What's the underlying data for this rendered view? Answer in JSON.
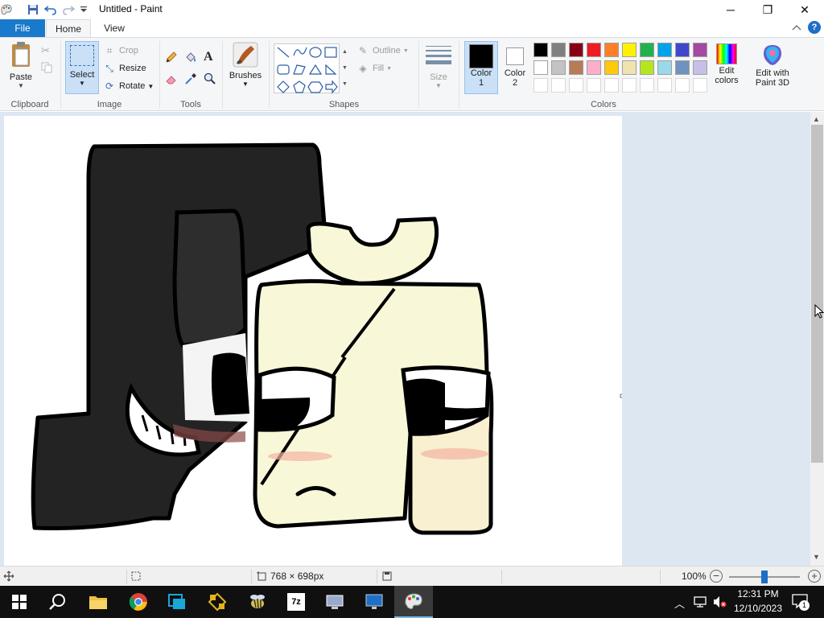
{
  "window": {
    "title": "Untitled - Paint",
    "minimize_glyph": "─",
    "restore_glyph": "❐",
    "close_glyph": "✕"
  },
  "tabs": [
    {
      "label": "File"
    },
    {
      "label": "Home"
    },
    {
      "label": "View"
    }
  ],
  "ribbon": {
    "clipboard": {
      "paste": "Paste",
      "group": "Clipboard"
    },
    "image": {
      "select": "Select",
      "crop": "Crop",
      "resize": "Resize",
      "rotate": "Rotate",
      "group": "Image"
    },
    "tools": {
      "group": "Tools"
    },
    "brushes": {
      "label": "Brushes"
    },
    "shapes": {
      "outline": "Outline",
      "fill": "Fill",
      "group": "Shapes"
    },
    "size": {
      "label": "Size"
    },
    "colors": {
      "color1": "Color",
      "color1_num": "1",
      "color2": "Color",
      "color2_num": "2",
      "edit_colors_1": "Edit",
      "edit_colors_2": "colors",
      "paint3d_1": "Edit with",
      "paint3d_2": "Paint 3D",
      "group": "Colors",
      "color1_value": "#000000",
      "color2_value": "#ffffff",
      "palette_row1": [
        "#000000",
        "#7f7f7f",
        "#880015",
        "#ed1c24",
        "#ff7f27",
        "#fff200",
        "#22b14c",
        "#00a2e8",
        "#3f48cc",
        "#a349a4"
      ],
      "palette_row2": [
        "#ffffff",
        "#c3c3c3",
        "#b97a57",
        "#ffaec9",
        "#ffc90e",
        "#efe4b0",
        "#b5e61d",
        "#99d9ea",
        "#7092be",
        "#c8bfe7"
      ]
    }
  },
  "status": {
    "dimensions": "768 × 698px",
    "zoom": "100%",
    "zoom_level_pct": 50
  },
  "taskbar": {
    "time": "12:31 PM",
    "date": "12/10/2023",
    "notification_count": "1"
  }
}
